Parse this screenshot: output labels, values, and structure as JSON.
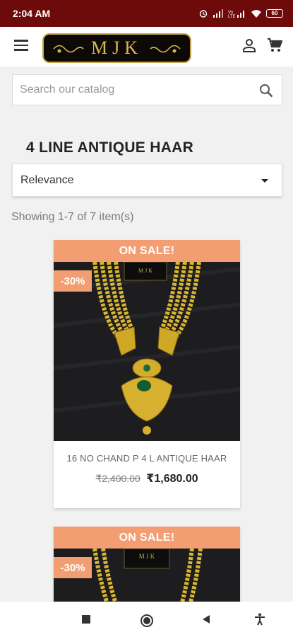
{
  "status_bar": {
    "time": "2:04 AM",
    "battery": "60"
  },
  "header": {
    "logo_text": "MJK",
    "icons": [
      "menu-icon",
      "user-icon",
      "cart-icon"
    ]
  },
  "search": {
    "placeholder": "Search our catalog",
    "icon": "search-icon"
  },
  "category": {
    "title": "4 LINE ANTIQUE HAAR"
  },
  "sort": {
    "selected": "Relevance"
  },
  "results": {
    "count_text": "Showing 1-7 of 7 item(s)"
  },
  "products": [
    {
      "flag": "ON SALE!",
      "discount": "-30%",
      "name": "16 NO CHAND P 4 L ANTIQUE HAAR",
      "old_price": "₹2,400.00",
      "price": "₹1,680.00"
    },
    {
      "flag": "ON SALE!",
      "discount": "-30%"
    }
  ],
  "colors": {
    "status_bar": "#6d0b0b",
    "sale_badge": "#f39d72",
    "logo_gold": "#d8b45a"
  }
}
